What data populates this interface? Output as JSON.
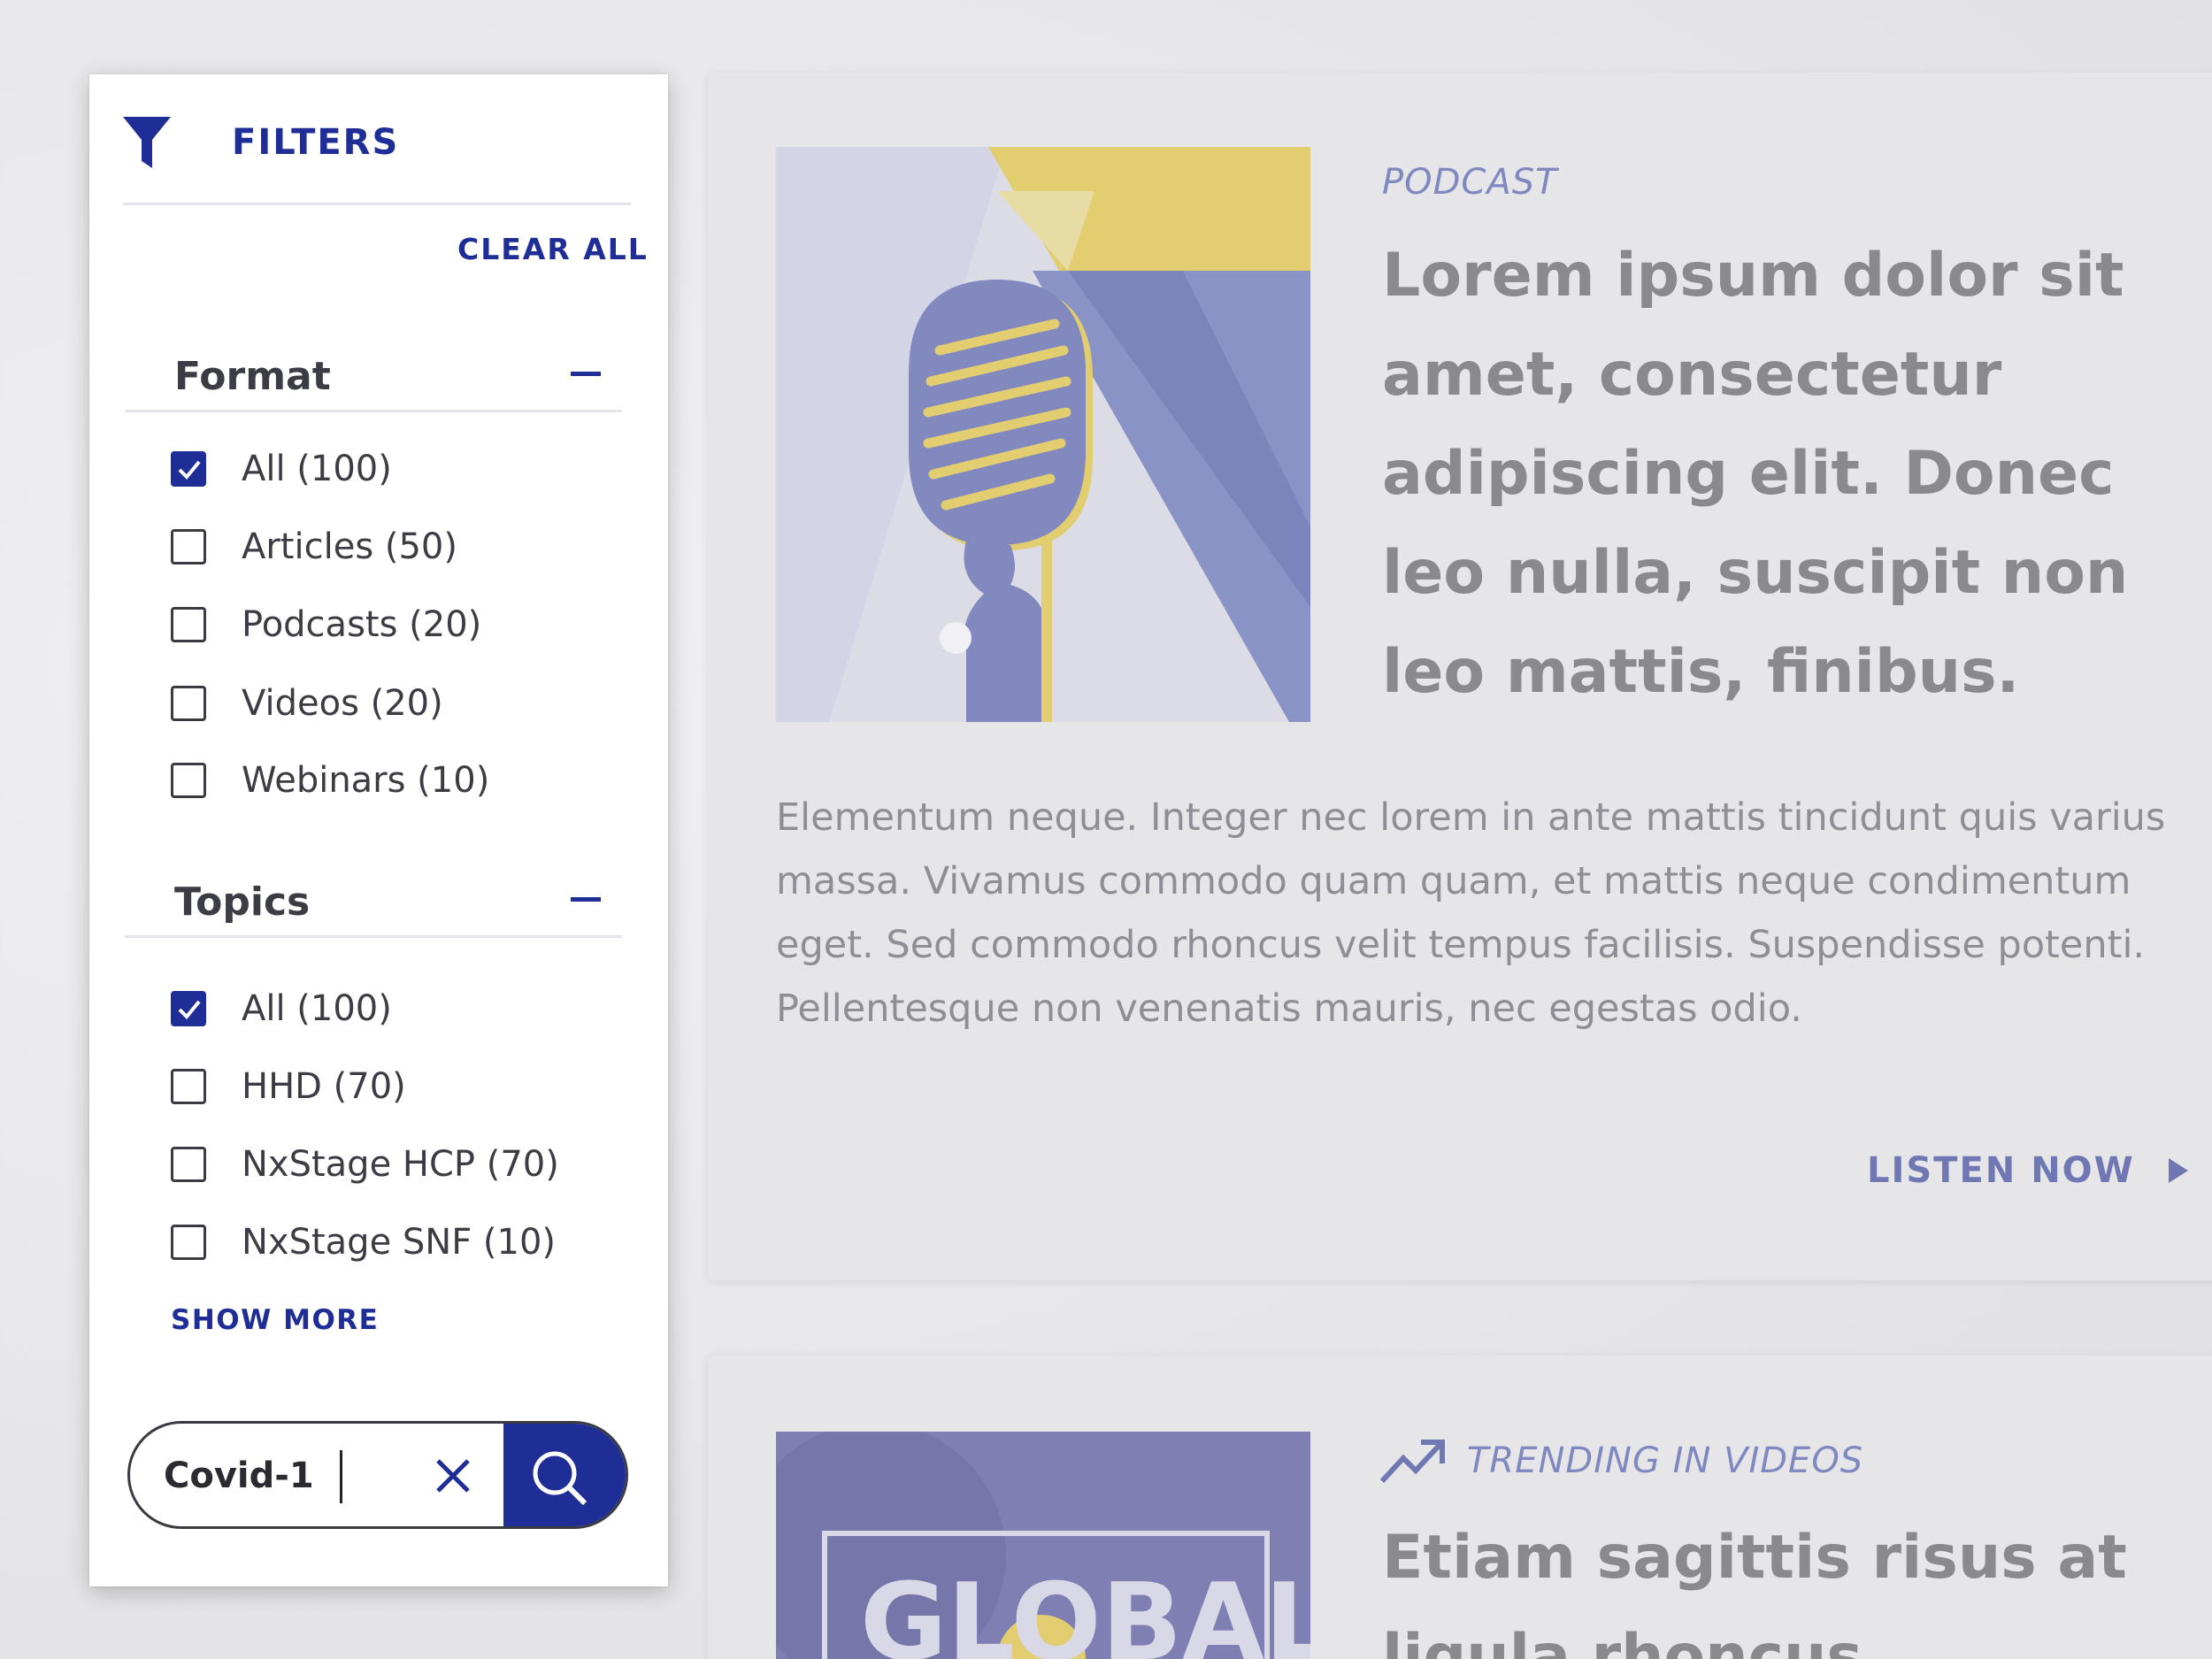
{
  "filters": {
    "title": "FILTERS",
    "clear_all": "CLEAR ALL",
    "format": {
      "title": "Format",
      "options": [
        {
          "label": "All (100)",
          "checked": true
        },
        {
          "label": "Articles (50)",
          "checked": false
        },
        {
          "label": "Podcasts (20)",
          "checked": false
        },
        {
          "label": "Videos (20)",
          "checked": false
        },
        {
          "label": "Webinars (10)",
          "checked": false
        }
      ]
    },
    "topics": {
      "title": "Topics",
      "options": [
        {
          "label": "All (100)",
          "checked": true
        },
        {
          "label": "HHD (70)",
          "checked": false
        },
        {
          "label": "NxStage HCP (70)",
          "checked": false
        },
        {
          "label": "NxStage SNF (10)",
          "checked": false
        }
      ]
    },
    "show_more": "SHOW MORE",
    "search": {
      "value": "Covid-1"
    }
  },
  "cards": [
    {
      "eyebrow": "PODCAST",
      "headline": "Lorem ipsum dolor sit amet, consectetur adipiscing elit. Donec leo nulla, suscipit non leo mattis, finibus.",
      "body": "Elementum neque. Integer nec lorem in ante mattis tincidunt quis varius massa. Vivamus commodo quam quam, et mattis neque condimentum eget. Sed commodo rhoncus velit tempus facilisis. Suspendisse potenti. Pellentesque non venenatis mauris, nec egestas odio.",
      "cta": "LISTEN NOW"
    },
    {
      "eyebrow": "TRENDING IN VIDEOS",
      "headline": "Etiam sagittis risus at ligula rhoncus",
      "image_text": "GLOBAL"
    }
  ],
  "colors": {
    "brand_blue": "#1e2e96",
    "accent_yellow": "#e2cd70",
    "muted_blue": "#8088c0"
  }
}
